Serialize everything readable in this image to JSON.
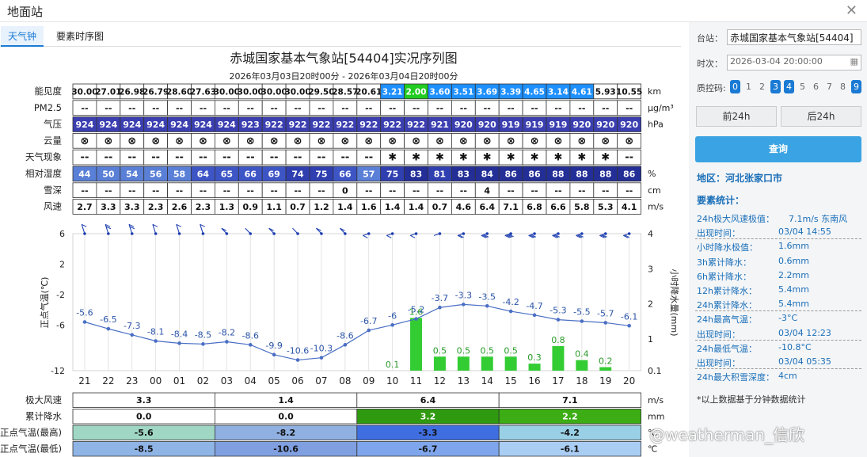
{
  "window": {
    "title": "地面站",
    "close_icon": "close-icon"
  },
  "tabs": [
    {
      "label": "天气钟"
    },
    {
      "label": "要素时序图"
    }
  ],
  "chart": {
    "title": "赤城国家基本气象站[54404]实况序列图",
    "subtitle": "2026年03月03日20时00分 - 2026年03月04日20时00分",
    "hours": [
      "21",
      "22",
      "23",
      "00",
      "01",
      "02",
      "03",
      "04",
      "05",
      "06",
      "07",
      "08",
      "09",
      "10",
      "11",
      "12",
      "13",
      "14",
      "15",
      "16",
      "17",
      "18",
      "19",
      "20"
    ],
    "table": [
      {
        "label": "能见度",
        "unit": "km",
        "values": [
          "30.00",
          "27.01",
          "26.98",
          "26.79",
          "28.60",
          "27.63",
          "30.00",
          "30.00",
          "30.00",
          "30.00",
          "29.50",
          "28.57",
          "20.61",
          "3.21",
          "2.00",
          "3.60",
          "3.51",
          "3.69",
          "3.39",
          "4.65",
          "3.14",
          "4.61",
          "5.93",
          "10.55"
        ],
        "colors": [
          "#fff",
          "#fff",
          "#fff",
          "#fff",
          "#fff",
          "#fff",
          "#fff",
          "#fff",
          "#fff",
          "#fff",
          "#fff",
          "#fff",
          "#fff",
          "#1e90ff",
          "#22cc22",
          "#1e90ff",
          "#1e90ff",
          "#1e90ff",
          "#1e90ff",
          "#1e90ff",
          "#1e90ff",
          "#1e90ff",
          "#fff",
          "#fff"
        ]
      },
      {
        "label": "PM2.5",
        "unit": "μg/m³",
        "values": [
          "--",
          "--",
          "--",
          "--",
          "--",
          "--",
          "--",
          "--",
          "--",
          "--",
          "--",
          "--",
          "--",
          "--",
          "--",
          "--",
          "--",
          "--",
          "--",
          "--",
          "--",
          "--",
          "--",
          "--"
        ]
      },
      {
        "label": "气压",
        "unit": "hPa",
        "values": [
          "924",
          "924",
          "924",
          "924",
          "924",
          "924",
          "924",
          "923",
          "922",
          "922",
          "922",
          "922",
          "922",
          "922",
          "922",
          "921",
          "920",
          "920",
          "919",
          "919",
          "919",
          "920",
          "920",
          "920"
        ]
      },
      {
        "label": "云量",
        "unit": "",
        "values": [
          "⊗",
          "⊗",
          "⊗",
          "⊗",
          "⊗",
          "⊗",
          "⊗",
          "⊗",
          "⊗",
          "⊗",
          "⊗",
          "⊗",
          "⊗",
          "⊗",
          "⊗",
          "⊗",
          "⊗",
          "⊗",
          "⊗",
          "⊗",
          "⊗",
          "⊗",
          "⊗",
          "⊗"
        ]
      },
      {
        "label": "天气现象",
        "unit": "",
        "values": [
          "--",
          "--",
          "--",
          "--",
          "--",
          "--",
          "--",
          "--",
          "--",
          "--",
          "--",
          "--",
          "--",
          "✱",
          "✱",
          "✱",
          "✱",
          "✱",
          "✱",
          "✱",
          "✱",
          "✱",
          "✱",
          "--"
        ]
      },
      {
        "label": "相对湿度",
        "unit": "%",
        "values": [
          "44",
          "50",
          "54",
          "56",
          "58",
          "64",
          "65",
          "66",
          "69",
          "74",
          "75",
          "66",
          "57",
          "75",
          "83",
          "81",
          "83",
          "84",
          "86",
          "86",
          "88",
          "88",
          "88",
          "86"
        ]
      },
      {
        "label": "雪深",
        "unit": "cm",
        "values": [
          "--",
          "--",
          "--",
          "--",
          "--",
          "--",
          "--",
          "--",
          "--",
          "--",
          "--",
          "0",
          "--",
          "--",
          "--",
          "--",
          "--",
          "4",
          "--",
          "--",
          "--",
          "--",
          "--",
          "--"
        ]
      },
      {
        "label": "风速",
        "unit": "m/s",
        "values": [
          "2.7",
          "3.3",
          "3.3",
          "2.3",
          "2.6",
          "2.3",
          "1.3",
          "0.9",
          "1.1",
          "0.7",
          "1.2",
          "1.4",
          "1.6",
          "1.4",
          "1.4",
          "0.7",
          "4.6",
          "6.4",
          "7.1",
          "6.8",
          "6.6",
          "5.8",
          "5.3",
          "4.1"
        ]
      }
    ],
    "left_axis": {
      "label": "正点气温(℃)",
      "ticks": [
        "6",
        "2",
        "-2",
        "-6",
        "-12"
      ]
    },
    "right_axis": {
      "label": "小时降水量(mm)",
      "ticks": [
        "4",
        "3",
        "2",
        "1",
        "0.1"
      ]
    },
    "bottom_table": [
      {
        "label": "极大风速",
        "unit": "m/s",
        "values": [
          "3.3",
          "1.4",
          "6.4",
          "7.1"
        ]
      },
      {
        "label": "累计降水",
        "unit": "mm",
        "values": [
          "0.0",
          "0.0",
          "3.2",
          "2.2"
        ]
      },
      {
        "label": "正点气温(最高)",
        "unit": "℃",
        "values": [
          "-5.6",
          "-8.2",
          "-3.3",
          "-4.2"
        ]
      },
      {
        "label": "正点气温(最低)",
        "unit": "℃",
        "values": [
          "-8.5",
          "-10.6",
          "-6.7",
          "-6.1"
        ]
      }
    ]
  },
  "chart_data": {
    "type": "line",
    "x": [
      "21",
      "22",
      "23",
      "00",
      "01",
      "02",
      "03",
      "04",
      "05",
      "06",
      "07",
      "08",
      "09",
      "10",
      "11",
      "12",
      "13",
      "14",
      "15",
      "16",
      "17",
      "18",
      "19",
      "20"
    ],
    "series": [
      {
        "name": "正点气温(℃)",
        "values": [
          -5.6,
          -6.5,
          -7.3,
          -8.1,
          -8.4,
          -8.5,
          -8.2,
          -8.6,
          -9.9,
          -10.6,
          -10.3,
          -8.6,
          -6.7,
          -6,
          -5.2,
          -3.7,
          -3.3,
          -3.5,
          -4.2,
          -4.7,
          -5.3,
          -5.5,
          -5.7,
          -6.1
        ]
      },
      {
        "name": "小时降水量(mm)",
        "type": "bar",
        "values": [
          null,
          null,
          null,
          null,
          null,
          null,
          null,
          null,
          null,
          null,
          null,
          null,
          null,
          0.1,
          1.6,
          0.5,
          0.5,
          0.5,
          0.5,
          0.3,
          0.8,
          0.4,
          0.2,
          null
        ]
      }
    ],
    "ylim_left": [
      -12,
      6
    ],
    "ylim_right": [
      0.1,
      4
    ]
  },
  "side": {
    "station_label": "台站：",
    "station_value": "赤城国家基本气象站[54404]",
    "time_label": "时次：",
    "time_value": "2026-03-04 20:00:00",
    "qc_label": "质控码:",
    "qc": [
      {
        "v": "0",
        "on": true
      },
      {
        "v": "1",
        "on": false
      },
      {
        "v": "2",
        "on": false
      },
      {
        "v": "3",
        "on": true
      },
      {
        "v": "4",
        "on": true
      },
      {
        "v": "5",
        "on": false
      },
      {
        "v": "6",
        "on": false
      },
      {
        "v": "7",
        "on": false
      },
      {
        "v": "8",
        "on": false
      },
      {
        "v": "9",
        "on": true
      }
    ],
    "prev": "前24h",
    "next": "后24h",
    "query": "查询",
    "region": "地区：河北张家口市",
    "stat_title": "要素统计：",
    "stats": [
      {
        "k": "24h极大风速极值：",
        "v": "7.1m/s 东南风"
      },
      {
        "k": "出现时间：",
        "v": "03/04 14:55"
      },
      {
        "k": "小时降水极值：",
        "v": "1.6mm"
      },
      {
        "k": "3h累计降水：",
        "v": "0.6mm"
      },
      {
        "k": "6h累计降水：",
        "v": "2.2mm"
      },
      {
        "k": "12h累计降水：",
        "v": "5.4mm"
      },
      {
        "k": "24h累计降水：",
        "v": "5.4mm"
      },
      {
        "k": "24h最高气温：",
        "v": "-3°C"
      },
      {
        "k": "出现时间：",
        "v": "03/04 12:23"
      },
      {
        "k": "24h最低气温：",
        "v": "-10.8°C"
      },
      {
        "k": "出现时间：",
        "v": "03/04 05:35"
      },
      {
        "k": "24h最大积雪深度：",
        "v": "4cm"
      }
    ],
    "note": "*以上数据基于分钟数据统计"
  },
  "watermark": "@weatherman_信欣"
}
